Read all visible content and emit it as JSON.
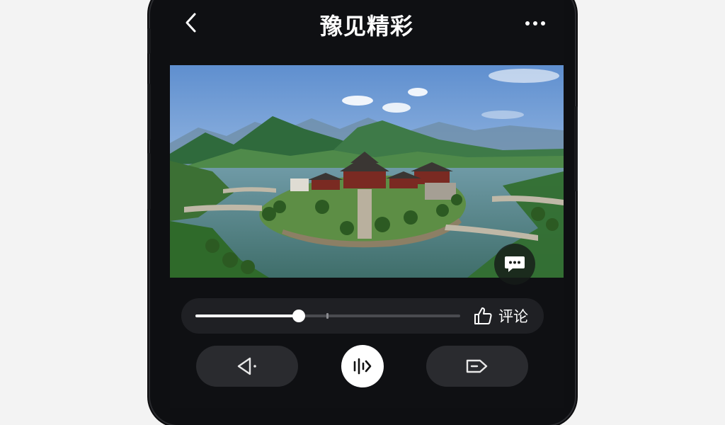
{
  "header": {
    "title": "豫见精彩"
  },
  "media": {
    "alt": "风景图片"
  },
  "player": {
    "progress": 0.39,
    "marker": 0.495,
    "comment_label": "评论"
  },
  "colors": {
    "background": "#0f1013",
    "pill": "#2a2b2f",
    "accent": "#ffffff"
  },
  "icons": [
    "back-icon",
    "more-icon",
    "chat-icon",
    "thumbs-up-icon",
    "speaker-icon",
    "voice-icon",
    "share-icon"
  ]
}
